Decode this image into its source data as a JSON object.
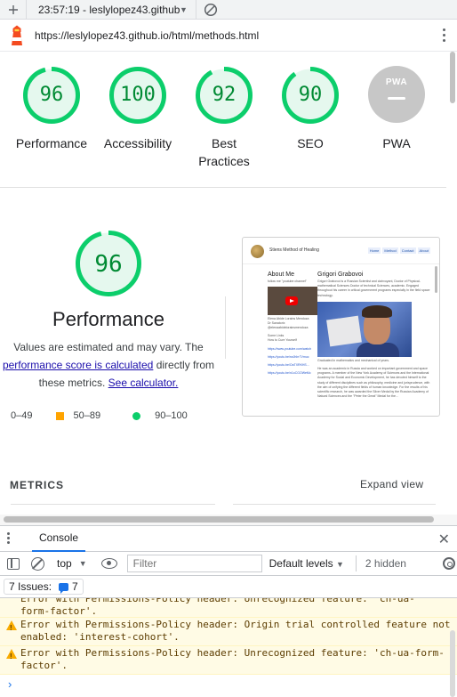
{
  "tab": {
    "title": "23:57:19 - leslylopez43.github"
  },
  "url": {
    "text": "https://leslylopez43.github.io/html/methods.html"
  },
  "scores": [
    {
      "value": "96",
      "label": "Performance",
      "fraction": 0.96
    },
    {
      "value": "100",
      "label": "Accessibility",
      "fraction": 1.0
    },
    {
      "value": "92",
      "label": "Best Practices",
      "fraction": 0.92
    },
    {
      "value": "90",
      "label": "SEO",
      "fraction": 0.9
    },
    {
      "value": "",
      "label": "PWA"
    }
  ],
  "pwa_badge_text": "PWA",
  "performance": {
    "score": "96",
    "score_fraction": 0.96,
    "title": "Performance",
    "desc_1": "Values are estimated and may vary. The",
    "link_1": "performance score is calculated",
    "desc_2": "directly from",
    "desc_3": "these metrics.",
    "link_2": "See calculator."
  },
  "legend": {
    "fail": "0–49",
    "average": "50–89",
    "pass": "90–100"
  },
  "thumbnail": {
    "brand": "Stiens Method of Healing",
    "nav": [
      "Home",
      "Method",
      "Contact",
      "About"
    ],
    "about_title": "About Me",
    "about_text": "follow me \"youtube channel\"",
    "caption_1": "Elena Abide Lorains Mendoza",
    "caption_2": "Dr Sanatorix",
    "caption_3": "@elenaabidelorainsmendoza",
    "sub_1": "Some Links",
    "sub_2": "How to Cure Yourself",
    "links": [
      "https://www.youtube.com/watch",
      "https://youtu.be/rwJhIrr7Vmuc",
      "https://youtu.be/OaTXRKHS...",
      "https://youtu.be/n1oCGOWeMc"
    ],
    "heading": "Grigori Grabovoi",
    "bio": "Grigori Grabovoi is a Russian Scientist and clairvoyant, Doctor of Physical-mathematical Sciences Doctor of technical Sciences, academic. Engaged throughout his career in critical government programs especially in the field space technology.",
    "photo_caption": "Graduated in mathematics and mechanical of years.",
    "bio_2": "He was an academic in Russia and worked on important government and space programs. A member of the New York Academy of Sciences and the International Academy for Social and Economic Development, he has devoted himself to the study of different disciplines such as philosophy, medicine and jurisprudence, with the aim of unifying the different fields of human knowledge. For the results of his scientific research, he was awarded the Silver Medal by the Russian Academy of Natural Sciences and the \"Peter the Great\" Medal for the..."
  },
  "metrics": {
    "title": "METRICS",
    "expand": "Expand view"
  },
  "devtools": {
    "console_tab": "Console",
    "context": "top",
    "filter_placeholder": "Filter",
    "levels": "Default levels",
    "hidden": "2 hidden",
    "issues_label": "7 Issues:",
    "issues_count": "7",
    "messages": [
      {
        "text": "form-factor'.",
        "partial_prev": "Error with Permissions-Policy header: Unrecognized feature: 'ch-ua-"
      },
      {
        "text": "Error with Permissions-Policy header: Origin trial controlled feature not enabled: 'interest-cohort'."
      },
      {
        "text": "Error with Permissions-Policy header: Unrecognized feature: 'ch-ua-form-factor'."
      }
    ]
  }
}
